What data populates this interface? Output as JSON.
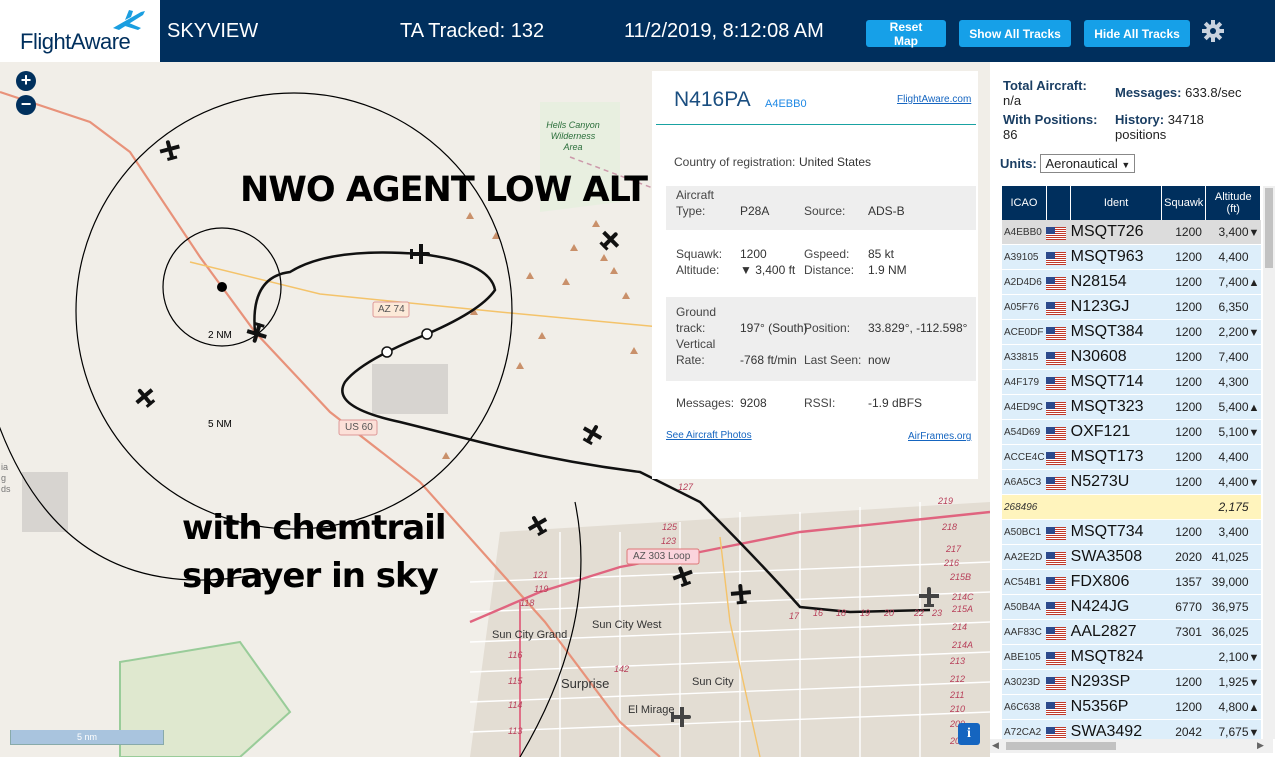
{
  "header": {
    "logo_text": "FlightAware",
    "app_name": "SKYVIEW",
    "tracked": "TA Tracked: 132",
    "datetime": "11/2/2019, 8:12:08 AM",
    "reset_label": "Reset Map",
    "show_label": "Show All Tracks",
    "hide_label": "Hide All Tracks"
  },
  "map": {
    "overlay_title": "NWO AGENT LOW ALT",
    "overlay_line1": "with chemtrail",
    "overlay_line2": "sprayer in sky",
    "scale_label": "5 nm",
    "ring_2nm": "2 NM",
    "ring_5nm": "5 NM",
    "wilderness": [
      "Hells Canyon",
      "Wilderness",
      "Area"
    ],
    "road_az74": "AZ 74",
    "road_us60": "US 60",
    "road_az303": "AZ 303 Loop",
    "town_sun_city_grand": "Sun City Grand",
    "town_sun_city_west": "Sun City West",
    "town_surprise": "Surprise",
    "town_sun_city": "Sun City",
    "town_el_mirage": "El Mirage",
    "left_edge": [
      "ia",
      "g",
      "ds"
    ],
    "road_numbers": [
      {
        "t": "127"
      },
      {
        "t": "125"
      },
      {
        "t": "123"
      },
      {
        "t": "121"
      },
      {
        "t": "119"
      },
      {
        "t": "118"
      },
      {
        "t": "116"
      },
      {
        "t": "115"
      },
      {
        "t": "114"
      },
      {
        "t": "113"
      },
      {
        "t": "142"
      },
      {
        "t": "17"
      },
      {
        "t": "16"
      },
      {
        "t": "18"
      },
      {
        "t": "19"
      },
      {
        "t": "20"
      },
      {
        "t": "22"
      },
      {
        "t": "23"
      },
      {
        "t": "219"
      },
      {
        "t": "218"
      },
      {
        "t": "217"
      },
      {
        "t": "216"
      },
      {
        "t": "215B"
      },
      {
        "t": "214C"
      },
      {
        "t": "215A"
      },
      {
        "t": "214A"
      },
      {
        "t": "214"
      },
      {
        "t": "213"
      },
      {
        "t": "212"
      },
      {
        "t": "211"
      },
      {
        "t": "210"
      },
      {
        "t": "209"
      },
      {
        "t": "208"
      }
    ],
    "info_label": "i"
  },
  "popup": {
    "registration": "N416PA",
    "hex": "A4EBB0",
    "fa_link": "FlightAware.com",
    "country_label": "Country of registration:",
    "country_value": "United States",
    "aircraft_label": "Aircraft",
    "type_label": "Type:",
    "type_value": "P28A",
    "source_label": "Source:",
    "source_value": "ADS-B",
    "squawk_label": "Squawk:",
    "squawk_value": "1200",
    "gspeed_label": "Gspeed:",
    "gspeed_value": "85 kt",
    "altitude_label": "Altitude:",
    "altitude_value": "▼ 3,400 ft",
    "distance_label": "Distance:",
    "distance_value": "1.9 NM",
    "ground_label": "Ground",
    "track_label": "track:",
    "track_value": "197° (South)",
    "position_label": "Position:",
    "position_value": "33.829°, -112.598°",
    "vertical_label": "Vertical",
    "rate_label": "Rate:",
    "rate_value": "-768 ft/min",
    "lastseen_label": "Last Seen:",
    "lastseen_value": "now",
    "messages_label": "Messages:",
    "messages_value": "9208",
    "rssi_label": "RSSI:",
    "rssi_value": "-1.9 dBFS",
    "photos_link": "See Aircraft Photos",
    "airframes_link": "AirFrames.org"
  },
  "sidebar": {
    "total_label": "Total Aircraft:",
    "total_value": "n/a",
    "messages_label": "Messages:",
    "messages_value": "633.8/sec",
    "positions_label": "With Positions:",
    "positions_value": "86",
    "history_label": "History:",
    "history_value": "34718",
    "history_unit": "positions",
    "units_label": "Units:",
    "units_value": "Aeronautical",
    "columns": {
      "icao": "ICAO",
      "ident": "Ident",
      "squawk": "Squawk",
      "altitude_1": "Altitude",
      "altitude_2": "(ft)"
    },
    "rows": [
      {
        "icao": "A4EBB0",
        "ident": "MSQT726",
        "squawk": "1200",
        "alt": "3,400",
        "trend": "▼",
        "flag": true,
        "state": "selected"
      },
      {
        "icao": "A39105",
        "ident": "MSQT963",
        "squawk": "1200",
        "alt": "4,400",
        "trend": "",
        "flag": true,
        "state": ""
      },
      {
        "icao": "A2D4D6",
        "ident": "N28154",
        "squawk": "1200",
        "alt": "7,400",
        "trend": "▲",
        "flag": true,
        "state": ""
      },
      {
        "icao": "A05F76",
        "ident": "N123GJ",
        "squawk": "1200",
        "alt": "6,350",
        "trend": "",
        "flag": true,
        "state": ""
      },
      {
        "icao": "ACE0DF",
        "ident": "MSQT384",
        "squawk": "1200",
        "alt": "2,200",
        "trend": "▼",
        "flag": true,
        "state": ""
      },
      {
        "icao": "A33815",
        "ident": "N30608",
        "squawk": "1200",
        "alt": "7,400",
        "trend": "",
        "flag": true,
        "state": ""
      },
      {
        "icao": "A4F179",
        "ident": "MSQT714",
        "squawk": "1200",
        "alt": "4,300",
        "trend": "",
        "flag": true,
        "state": ""
      },
      {
        "icao": "A4ED9C",
        "ident": "MSQT323",
        "squawk": "1200",
        "alt": "5,400",
        "trend": "▲",
        "flag": true,
        "state": ""
      },
      {
        "icao": "A54D69",
        "ident": "OXF121",
        "squawk": "1200",
        "alt": "5,100",
        "trend": "▼",
        "flag": true,
        "state": ""
      },
      {
        "icao": "ACCE4C",
        "ident": "MSQT173",
        "squawk": "1200",
        "alt": "4,400",
        "trend": "",
        "flag": true,
        "state": ""
      },
      {
        "icao": "A6A5C3",
        "ident": "N5273U",
        "squawk": "1200",
        "alt": "4,400",
        "trend": "▼",
        "flag": true,
        "state": ""
      },
      {
        "icao": "268496",
        "ident": "",
        "squawk": "",
        "alt": "2,175",
        "trend": "",
        "flag": false,
        "state": "mlat"
      },
      {
        "icao": "A50BC1",
        "ident": "MSQT734",
        "squawk": "1200",
        "alt": "3,400",
        "trend": "",
        "flag": true,
        "state": ""
      },
      {
        "icao": "AA2E2D",
        "ident": "SWA3508",
        "squawk": "2020",
        "alt": "41,025",
        "trend": "",
        "flag": true,
        "state": ""
      },
      {
        "icao": "AC54B1",
        "ident": "FDX806",
        "squawk": "1357",
        "alt": "39,000",
        "trend": "",
        "flag": true,
        "state": ""
      },
      {
        "icao": "A50B4A",
        "ident": "N424JG",
        "squawk": "6770",
        "alt": "36,975",
        "trend": "",
        "flag": true,
        "state": ""
      },
      {
        "icao": "AAF83C",
        "ident": "AAL2827",
        "squawk": "7301",
        "alt": "36,025",
        "trend": "",
        "flag": true,
        "state": ""
      },
      {
        "icao": "ABE105",
        "ident": "MSQT824",
        "squawk": "",
        "alt": "2,100",
        "trend": "▼",
        "flag": true,
        "state": ""
      },
      {
        "icao": "A3023D",
        "ident": "N293SP",
        "squawk": "1200",
        "alt": "1,925",
        "trend": "▼",
        "flag": true,
        "state": ""
      },
      {
        "icao": "A6C638",
        "ident": "N5356P",
        "squawk": "1200",
        "alt": "4,800",
        "trend": "▲",
        "flag": true,
        "state": ""
      },
      {
        "icao": "A72CA2",
        "ident": "SWA3492",
        "squawk": "2042",
        "alt": "7,675",
        "trend": "▼",
        "flag": true,
        "state": ""
      }
    ]
  },
  "colors": {
    "header_bg": "#002f5d",
    "button_bg": "#16a0e8",
    "table_header_bg": "#002f5d",
    "row_bg": "#ddeefa",
    "selected_row_bg": "#dcdcdc",
    "mlat_row_bg": "#fff4bd"
  }
}
